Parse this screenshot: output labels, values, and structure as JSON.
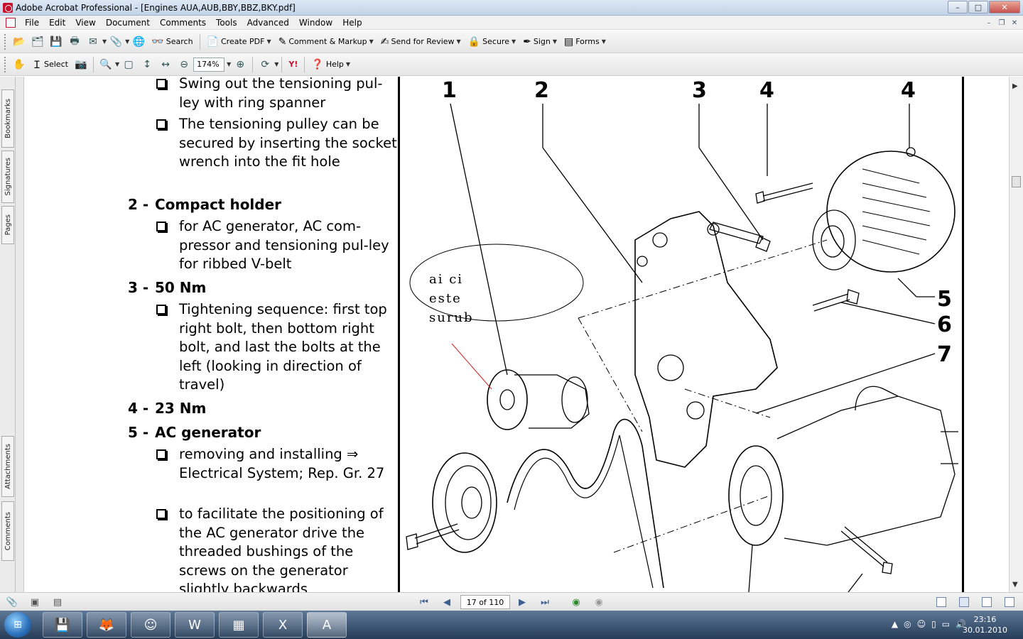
{
  "window": {
    "title": "Adobe Acrobat Professional - [Engines AUA,AUB,BBY,BBZ,BKY.pdf]",
    "controls": [
      "–",
      "□",
      "✕"
    ]
  },
  "menu": [
    "File",
    "Edit",
    "View",
    "Document",
    "Comments",
    "Tools",
    "Advanced",
    "Window",
    "Help"
  ],
  "toolbar1": {
    "search": "Search",
    "create_pdf": "Create PDF",
    "comment_markup": "Comment & Markup",
    "send_review": "Send for Review",
    "secure": "Secure",
    "sign": "Sign",
    "forms": "Forms"
  },
  "toolbar2": {
    "select": "Select",
    "zoom": "174%",
    "help": "Help",
    "yahoo": "Y!"
  },
  "nav_tabs": {
    "bookmarks": "Bookmarks",
    "signatures": "Signatures",
    "pages": "Pages",
    "attachments": "Attachments",
    "comments": "Comments"
  },
  "document": {
    "bullets_top": [
      "Swing out the tensioning pul-ley with ring spanner",
      "The tensioning pulley can be secured by inserting the socket wrench into the fit hole"
    ],
    "items": [
      {
        "num": "2 -",
        "title": "Compact holder",
        "bullets": [
          "for AC generator, AC com-pressor and tensioning pul-ley for ribbed V-belt"
        ]
      },
      {
        "num": "3 -",
        "title": "50 Nm",
        "bullets": [
          "Tightening sequence: first top right bolt, then bottom right bolt, and last the bolts at the left (looking in direction of travel)"
        ]
      },
      {
        "num": "4 -",
        "title": "23 Nm",
        "bullets": []
      },
      {
        "num": "5 -",
        "title": "AC generator",
        "bullets": [
          "removing and installing ⇒ Electrical System; Rep. Gr. 27",
          "to facilitate the positioning of the AC generator drive the threaded bushings of the screws on the generator slightly backwards"
        ]
      }
    ],
    "figure_callouts": [
      "1",
      "2",
      "3",
      "4",
      "4",
      "5",
      "6",
      "7"
    ],
    "annotation_lines": [
      "ai ci",
      "este",
      "surub"
    ]
  },
  "status": {
    "page": "17 of 110"
  },
  "taskbar": {
    "time": "23:16",
    "date": "30.01.2010"
  }
}
